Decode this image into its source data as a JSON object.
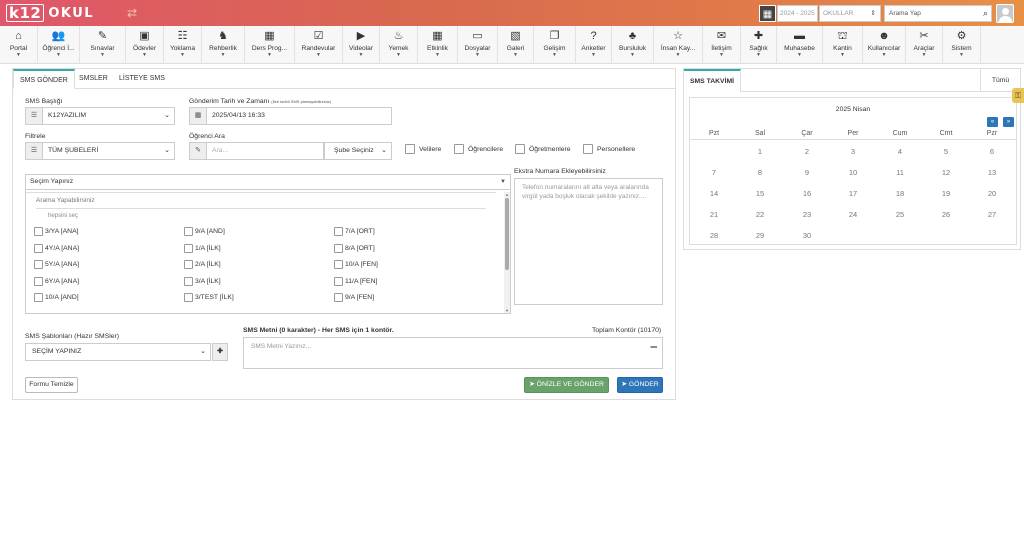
{
  "header": {
    "logo_prefix": "k12",
    "logo_suffix": "OKUL",
    "year": "2024 - 2025",
    "schools": "OKULLAR",
    "search_placeholder": "Arama Yap"
  },
  "nav": [
    {
      "label": "Portal",
      "icon": "⌂",
      "icon_name": "home-icon"
    },
    {
      "label": "Öğrenci İ...",
      "icon": "👥",
      "icon_name": "users-icon"
    },
    {
      "label": "Sınavlar",
      "icon": "✎",
      "icon_name": "exam-icon"
    },
    {
      "label": "Ödevler",
      "icon": "▣",
      "icon_name": "homework-icon"
    },
    {
      "label": "Yoklama",
      "icon": "☷",
      "icon_name": "rss-icon"
    },
    {
      "label": "Rehberlik",
      "icon": "♞",
      "icon_name": "guidance-icon"
    },
    {
      "label": "Ders Prog...",
      "icon": "▦",
      "icon_name": "table-icon"
    },
    {
      "label": "Randevular",
      "icon": "☑",
      "icon_name": "calendar-check-icon"
    },
    {
      "label": "Videolar",
      "icon": "▶",
      "icon_name": "video-icon"
    },
    {
      "label": "Yemek",
      "icon": "♨",
      "icon_name": "food-icon"
    },
    {
      "label": "Etkinlik",
      "icon": "▦",
      "icon_name": "calendar-icon"
    },
    {
      "label": "Dosyalar",
      "icon": "▭",
      "icon_name": "folder-icon"
    },
    {
      "label": "Galeri",
      "icon": "▧",
      "icon_name": "image-icon"
    },
    {
      "label": "Gelişim",
      "icon": "❐",
      "icon_name": "copy-icon"
    },
    {
      "label": "Anketler",
      "icon": "?",
      "icon_name": "question-icon"
    },
    {
      "label": "Bursluluk",
      "icon": "♣",
      "icon_name": "sitemap-icon"
    },
    {
      "label": "İnsan Kay...",
      "icon": "☆",
      "icon_name": "star-icon"
    },
    {
      "label": "İletişim",
      "icon": "✉",
      "icon_name": "envelope-icon"
    },
    {
      "label": "Sağlık",
      "icon": "✚",
      "icon_name": "health-icon"
    },
    {
      "label": "Muhasebe",
      "icon": "▬",
      "icon_name": "credit-card-icon"
    },
    {
      "label": "Kantin",
      "icon": "⛫",
      "icon_name": "basket-icon"
    },
    {
      "label": "Kullanıcılar",
      "icon": "☻",
      "icon_name": "user-icon"
    },
    {
      "label": "Araçlar",
      "icon": "✂",
      "icon_name": "wrench-icon"
    },
    {
      "label": "Sistem",
      "icon": "⚙",
      "icon_name": "gears-icon"
    }
  ],
  "tabs": [
    "SMS GÖNDER",
    "SMSLER",
    "LİSTEYE SMS"
  ],
  "form": {
    "sms_title_label": "SMS Başlığı",
    "sms_title_value": "K12YAZILIM",
    "send_date_label": "Gönderim Tarih ve Zamanı",
    "send_date_note": "(İleri tarihli SMS planlayabilirsiniz)",
    "send_date_value": "2025/04/13 16:33",
    "filter_label": "Filtrele",
    "filter_value": "TÜM ŞUBELERİ",
    "student_search_label": "Öğrenci Ara",
    "student_search_placeholder": "Ara...",
    "branch_select": "Şube Seçiniz",
    "recipients": [
      "Velilere",
      "Öğrencilere",
      "Öğretmenlere",
      "Personellere"
    ],
    "class_select_placeholder": "Seçim Yapınız",
    "class_search_placeholder": "Arama Yapabilirsiniz",
    "select_all": "hepsini seç",
    "class_options": [
      [
        "3/YA [ANA]",
        "9/A [AND]",
        "7/A [ORT]"
      ],
      [
        "4Y/A [ANA]",
        "1/A [İLK]",
        "8/A [ORT]"
      ],
      [
        "5Y/A [ANA]",
        "2/A [İLK]",
        "10/A [FEN]"
      ],
      [
        "6Y/A [ANA]",
        "3/A [İLK]",
        "11/A [FEN]"
      ],
      [
        "10/A [AND]",
        "3/TEST [İLK]",
        "9/A [FEN]"
      ]
    ],
    "extra_numbers_label": "Ekstra Numara Ekleyebilirsiniz",
    "extra_numbers_placeholder": "Telefon numaralarını alt alta veya aralarında virgül yada boşluk olacak şekilde yazınız....",
    "templates_label": "SMS Şablonları (Hazır SMSler)",
    "templates_value": "SEÇİM YAPINIZ",
    "sms_text_label": "SMS Metni (0 karakter) - Her SMS için 1 kontör.",
    "total_credit": "Toplam Kontör (10170)",
    "sms_text_placeholder": "SMS Metni Yazınız...",
    "clear_button": "Formu Temizle",
    "preview_send_button": "ÖNİZLE VE GÖNDER",
    "send_button": "GÖNDER"
  },
  "calendar": {
    "tab": "SMS TAKVİMİ",
    "all": "Tümü",
    "title": "2025 Nisan",
    "prev": "«",
    "next": "»",
    "days_of_week": [
      "Pzt",
      "Sal",
      "Çar",
      "Per",
      "Cum",
      "Cmt",
      "Pzr"
    ],
    "weeks": [
      [
        "",
        "1",
        "2",
        "3",
        "4",
        "5",
        "6"
      ],
      [
        "7",
        "8",
        "9",
        "10",
        "11",
        "12",
        "13"
      ],
      [
        "14",
        "15",
        "16",
        "17",
        "18",
        "19",
        "20"
      ],
      [
        "21",
        "22",
        "23",
        "24",
        "25",
        "26",
        "27"
      ],
      [
        "28",
        "29",
        "30",
        "",
        "",
        "",
        ""
      ]
    ]
  },
  "side_tab_icon": "key-icon"
}
